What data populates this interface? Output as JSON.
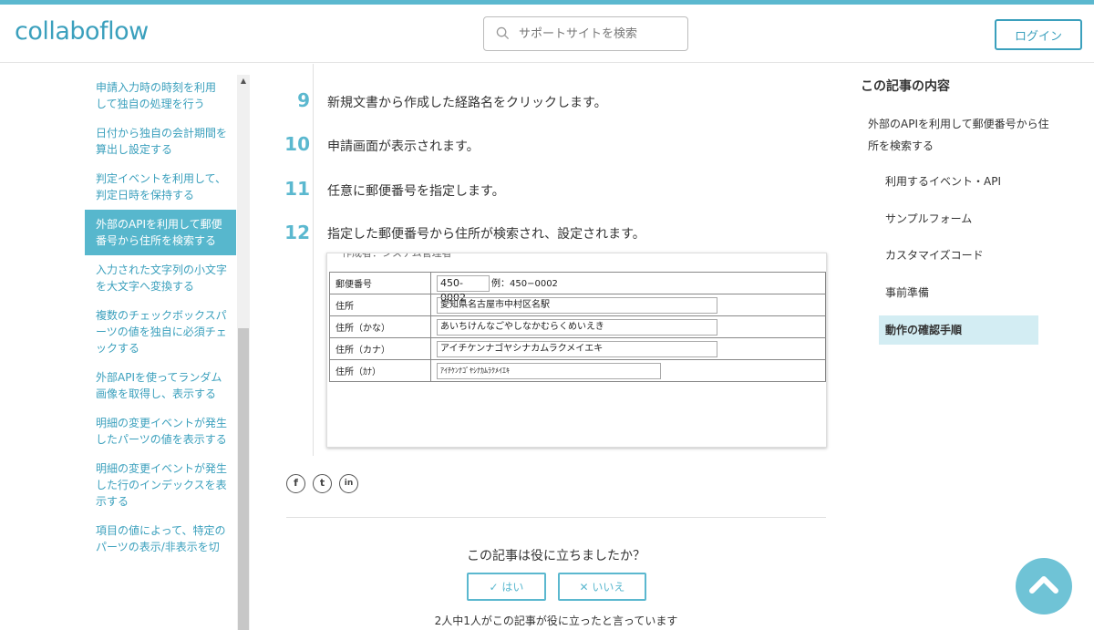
{
  "header": {
    "logo": "collaboflow",
    "search_placeholder": "サポートサイトを検索",
    "login_label": "ログイン"
  },
  "sidebar": {
    "items": [
      {
        "label": "申請入力時の時刻を利用して独自の処理を行う",
        "active": false
      },
      {
        "label": "日付から独自の会計期間を算出し設定する",
        "active": false
      },
      {
        "label": "判定イベントを利用して、判定日時を保持する",
        "active": false
      },
      {
        "label": "外部のAPIを利用して郵便番号から住所を検索する",
        "active": true
      },
      {
        "label": "入力された文字列の小文字を大文字へ変換する",
        "active": false
      },
      {
        "label": "複数のチェックボックスパーツの値を独自に必須チェックする",
        "active": false
      },
      {
        "label": "外部APIを使ってランダム画像を取得し、表示する",
        "active": false
      },
      {
        "label": "明細の変更イベントが発生したパーツの値を表示する",
        "active": false
      },
      {
        "label": "明細の変更イベントが発生した行のインデックスを表示する",
        "active": false
      },
      {
        "label": "項目の値によって、特定のパーツの表示/非表示を切",
        "active": false
      }
    ]
  },
  "main": {
    "steps": [
      {
        "num": "9",
        "text": "新規文書から作成した経路名をクリックします。"
      },
      {
        "num": "10",
        "text": "申請画面が表示されます。"
      },
      {
        "num": "11",
        "text": "任意に郵便番号を指定します。"
      },
      {
        "num": "12",
        "text": "指定した郵便番号から住所が検索され、設定されます。"
      }
    ],
    "form": {
      "cut_text": "作成者：システム管理者",
      "postal_label": "郵便番号",
      "postal_value": "450-0002",
      "postal_hint": "例：450−0002",
      "address_label": "住所",
      "address_value": "愛知県名古屋市中村区名駅",
      "kana_label": "住所（かな）",
      "kana_value": "あいちけんなごやしなかむらくめいえき",
      "katakana_label": "住所（カナ）",
      "katakana_value": "アイチケンナゴヤシナカムラクメイエキ",
      "halfkana_label": "住所（ｶﾅ）",
      "halfkana_value": "ｱｲﾁｹﾝﾅｺﾞﾔｼﾅｶﾑﾗｸﾒｲｴｷ"
    },
    "social": {
      "facebook": "f",
      "twitter": "t",
      "linkedin": "in"
    },
    "helpful": {
      "question": "この記事は役に立ちましたか？",
      "yes_label": "はい",
      "no_label": "いいえ",
      "vote_count": "2人中1人がこの記事が役に立ったと言っています"
    }
  },
  "toc": {
    "title": "この記事の内容",
    "top_item": "外部のAPIを利用して郵便番号から住所を検索する",
    "items": [
      {
        "label": "利用するイベント・API",
        "current": false
      },
      {
        "label": "サンプルフォーム",
        "current": false
      },
      {
        "label": "カスタマイズコード",
        "current": false
      },
      {
        "label": "事前準備",
        "current": false
      },
      {
        "label": "動作の確認手順",
        "current": true
      }
    ]
  },
  "colors": {
    "accent": "#3ba0bd",
    "active_bg": "#57b7cd",
    "toc_current_bg": "#d3edf3"
  }
}
